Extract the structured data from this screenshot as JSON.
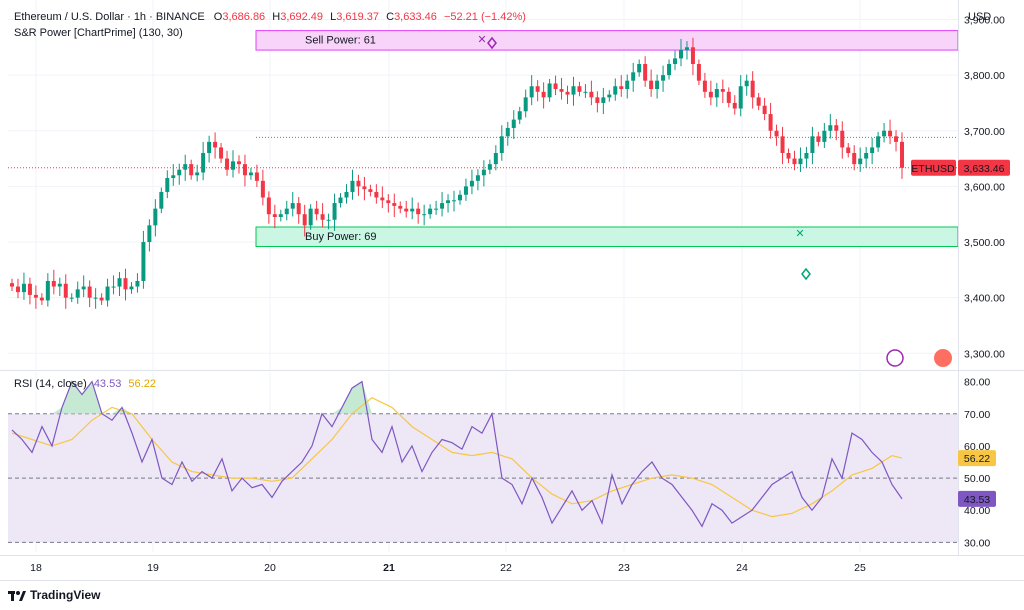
{
  "header": {
    "symbol": "Ethereum / U.S. Dollar · 1h · BINANCE",
    "o_label": "O",
    "o_value": "3,686.86",
    "h_label": "H",
    "h_value": "3,692.49",
    "l_label": "L",
    "l_value": "3,619.37",
    "c_label": "C",
    "c_value": "3,633.46",
    "change": "−52.21 (−1.42%)",
    "indicator": "S&R Power [ChartPrime] (130, 30)"
  },
  "price_axis": {
    "currency": "USD",
    "ticks": [
      "3,900.00",
      "3,800.00",
      "3,700.00",
      "3,600.00",
      "3,500.00",
      "3,400.00",
      "3,300.00"
    ]
  },
  "price_label": {
    "symbol": "ETHUSD",
    "value": "3,633.46"
  },
  "zones": {
    "sell_label": "Sell Power: 61",
    "buy_label": "Buy Power: 69"
  },
  "rsi": {
    "title": "RSI (14, close)",
    "rsi_value": "43.53",
    "ma_value": "56.22",
    "ticks": [
      "80.00",
      "70.00",
      "60.00",
      "50.00",
      "40.00",
      "30.00"
    ],
    "badge_ma": "56.22",
    "badge_rsi": "43.53"
  },
  "x_axis": {
    "ticks": [
      "18",
      "19",
      "20",
      "21",
      "22",
      "23",
      "24",
      "25"
    ]
  },
  "branding": {
    "name": "TradingView"
  },
  "colors": {
    "up": "#089981",
    "down": "#f23645",
    "rsi": "#7e57c2",
    "rsi_ma": "#f7c744",
    "sell_zone": "#e040fb",
    "buy_zone": "#00c853"
  },
  "chart_data": [
    {
      "type": "candlestick",
      "title": "Ethereum / U.S. Dollar · 1h · BINANCE",
      "xlabel": "",
      "ylabel": "",
      "x_ticks": [
        "18",
        "19",
        "20",
        "21",
        "22",
        "23",
        "24",
        "25"
      ],
      "ylim": [
        3270,
        3935
      ],
      "series": [
        {
          "name": "close_path_approx",
          "x": [
            0,
            6,
            12,
            18,
            24,
            30,
            36,
            42,
            48,
            54,
            60,
            66,
            72,
            78,
            84,
            90,
            96,
            102,
            108,
            114,
            120,
            126,
            132,
            138,
            144,
            150,
            156,
            162,
            168,
            174,
            180,
            186,
            192,
            198,
            204,
            210,
            216,
            222,
            228,
            234,
            240,
            246,
            252,
            258,
            264,
            270,
            276,
            282,
            288,
            294,
            300,
            306,
            312,
            318,
            324,
            330,
            336,
            342,
            348,
            354,
            360,
            366,
            372,
            378,
            384,
            390,
            396,
            402,
            408,
            414,
            420,
            426,
            432,
            438,
            444,
            450,
            456,
            462,
            468,
            474,
            480,
            486,
            492,
            498,
            504,
            510,
            516,
            522,
            528,
            534,
            540,
            546,
            552,
            558,
            564,
            570,
            576,
            582,
            588,
            594,
            600,
            606,
            612,
            618,
            624,
            630,
            636,
            642,
            648,
            654,
            660,
            666,
            672,
            678,
            684,
            690,
            696,
            702,
            708,
            714,
            720,
            726,
            732,
            738,
            744,
            750,
            756,
            762,
            768,
            774,
            780,
            786,
            792,
            798,
            804,
            810,
            816,
            822,
            828,
            834,
            840,
            846,
            852,
            858,
            864,
            870,
            876,
            882,
            888,
            894
          ],
          "values": [
            3420,
            3410,
            3425,
            3405,
            3400,
            3395,
            3430,
            3420,
            3425,
            3400,
            3400,
            3415,
            3420,
            3400,
            3400,
            3395,
            3420,
            3420,
            3435,
            3415,
            3420,
            3430,
            3500,
            3530,
            3560,
            3590,
            3615,
            3620,
            3630,
            3640,
            3620,
            3625,
            3660,
            3680,
            3670,
            3650,
            3630,
            3645,
            3640,
            3620,
            3625,
            3610,
            3580,
            3550,
            3545,
            3550,
            3560,
            3570,
            3550,
            3530,
            3560,
            3550,
            3540,
            3540,
            3570,
            3580,
            3590,
            3610,
            3600,
            3595,
            3590,
            3580,
            3575,
            3570,
            3565,
            3560,
            3555,
            3560,
            3550,
            3550,
            3560,
            3560,
            3570,
            3575,
            3575,
            3585,
            3600,
            3610,
            3620,
            3630,
            3640,
            3660,
            3690,
            3705,
            3720,
            3735,
            3760,
            3780,
            3770,
            3760,
            3785,
            3775,
            3770,
            3765,
            3780,
            3770,
            3770,
            3760,
            3750,
            3760,
            3765,
            3780,
            3775,
            3790,
            3805,
            3820,
            3790,
            3775,
            3790,
            3800,
            3820,
            3830,
            3845,
            3850,
            3820,
            3790,
            3770,
            3760,
            3775,
            3770,
            3750,
            3740,
            3780,
            3790,
            3760,
            3745,
            3730,
            3700,
            3690,
            3660,
            3650,
            3640,
            3650,
            3660,
            3690,
            3680,
            3700,
            3710,
            3700,
            3670,
            3660,
            3640,
            3650,
            3660,
            3670,
            3690,
            3700,
            3690,
            3680,
            3633.46
          ]
        }
      ],
      "last_close": 3633.46
    },
    {
      "type": "line",
      "title": "RSI (14, close)",
      "xlabel": "",
      "ylabel": "",
      "ylim": [
        27,
        83
      ],
      "series": [
        {
          "name": "RSI",
          "x": [
            0,
            10,
            20,
            30,
            40,
            50,
            60,
            70,
            80,
            90,
            100,
            110,
            120,
            130,
            140,
            150,
            160,
            170,
            180,
            190,
            200,
            210,
            220,
            230,
            240,
            250,
            260,
            270,
            280,
            290,
            300,
            310,
            320,
            330,
            340,
            350,
            360,
            370,
            380,
            390,
            400,
            410,
            420,
            430,
            440,
            450,
            460,
            470,
            480,
            490,
            500,
            510,
            520,
            530,
            540,
            550,
            560,
            570,
            580,
            590,
            600,
            610,
            620,
            630,
            640,
            650,
            660,
            670,
            680,
            690,
            700,
            710,
            720,
            730,
            740,
            750,
            760,
            770,
            780,
            790,
            800,
            810,
            820,
            830,
            840,
            850,
            860,
            870,
            880,
            890
          ],
          "values": [
            65,
            62,
            58,
            66,
            60,
            72,
            80,
            76,
            80,
            70,
            68,
            72,
            64,
            55,
            62,
            50,
            48,
            55,
            49,
            52,
            50,
            56,
            46,
            50,
            47,
            48,
            44,
            49,
            52,
            55,
            60,
            70,
            66,
            72,
            78,
            80,
            62,
            58,
            66,
            55,
            60,
            52,
            58,
            62,
            61,
            59,
            66,
            64,
            70,
            50,
            48,
            42,
            50,
            44,
            36,
            41,
            46,
            40,
            43,
            36,
            51,
            42,
            48,
            52,
            55,
            50,
            48,
            44,
            40,
            35,
            42,
            40,
            36,
            38,
            40,
            44,
            48,
            50,
            52,
            44,
            40,
            44,
            56,
            50,
            64,
            62,
            58,
            55,
            48,
            43.53
          ]
        },
        {
          "name": "RSI-based MA",
          "x": [
            0,
            20,
            40,
            60,
            80,
            100,
            120,
            140,
            160,
            180,
            200,
            220,
            240,
            260,
            280,
            300,
            320,
            340,
            360,
            380,
            400,
            420,
            440,
            460,
            480,
            500,
            520,
            540,
            560,
            580,
            600,
            620,
            640,
            660,
            680,
            700,
            720,
            740,
            760,
            780,
            800,
            820,
            840,
            860,
            880,
            890
          ],
          "values": [
            64,
            62,
            60,
            62,
            68,
            72,
            70,
            62,
            55,
            52,
            51,
            50,
            50,
            49,
            50,
            56,
            62,
            70,
            75,
            72,
            66,
            62,
            58,
            57,
            58,
            56,
            50,
            45,
            42,
            43,
            46,
            48,
            50,
            51,
            50,
            48,
            44,
            40,
            38,
            39,
            42,
            46,
            51,
            53,
            57,
            56.22
          ]
        }
      ],
      "reference_lines": [
        70,
        50,
        30
      ],
      "last_values": {
        "RSI": 43.53,
        "RSI-based MA": 56.22
      }
    }
  ]
}
